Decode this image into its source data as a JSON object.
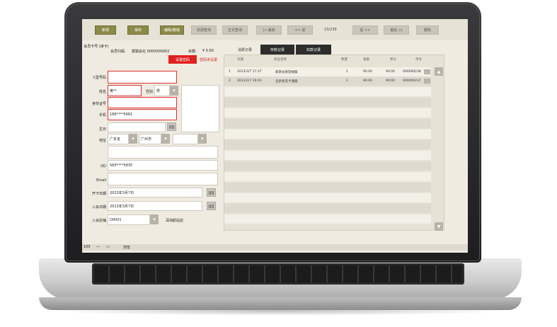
{
  "toolbar": {
    "buttons": [
      {
        "label": "新增",
        "style": "olive"
      },
      {
        "label": "保存",
        "style": "olive"
      },
      {
        "label": "编辑/撤销",
        "style": "olive"
      },
      {
        "label": "前调查询",
        "style": "gray"
      },
      {
        "label": "正式查询",
        "style": "gray"
      },
      {
        "label": "|< 最前",
        "style": "gray"
      },
      {
        "label": "<< 前",
        "style": "gray"
      },
      {
        "label": "后 >>",
        "style": "gray"
      },
      {
        "label": "最后 >|",
        "style": "gray"
      },
      {
        "label": "删除",
        "style": "gray"
      }
    ],
    "record_counter": "23/239"
  },
  "member": {
    "card_label": "会员卡号 (读卡)",
    "store_label": "会员归属:",
    "store_value": "猿猿会社 0000000002",
    "balance_label": "余额:",
    "balance_value": "¥ 0.00",
    "set_password_button": "设置密码",
    "reset_password_link": "密码未设置"
  },
  "form": {
    "fields": [
      {
        "label": "C型号码",
        "value": ""
      },
      {
        "label": "姓名",
        "value": "黄**"
      },
      {
        "label": "身份证号",
        "value": ""
      },
      {
        "label": "手机",
        "value": "186****5681"
      },
      {
        "label": "生日",
        "value": ""
      },
      {
        "label": "地址",
        "value": ""
      },
      {
        "label": "QQ",
        "value": "565****5835"
      },
      {
        "label": "Email",
        "value": ""
      },
      {
        "label": "开卡日期",
        "value": "2013年3月7日"
      },
      {
        "label": "入会日期",
        "value": "2013年3月7日"
      },
      {
        "label": "入会店铺",
        "value": "D0001"
      }
    ],
    "gender_label": "性别",
    "gender_value": "男",
    "province_value": "广东省",
    "city_value": "广州市",
    "store_name": "深圳航站店"
  },
  "tabs": [
    "消费记录",
    "存款记录",
    "扣款记录"
  ],
  "grid": {
    "headers": [
      "日期",
      "商品名称",
      "数量",
      "金额",
      "积分",
      "单号"
    ],
    "rows": [
      {
        "no": "1",
        "date": "2013/3/7 17:37",
        "product": "新款长款羽绒服",
        "qty": "1",
        "amount": "¥0.00",
        "points": "¥0.00",
        "order": "000000238"
      },
      {
        "no": "2",
        "date": "2013/3/7 16:03",
        "product": "全新冬装卡通服",
        "qty": "1",
        "amount": "¥0.00",
        "points": "¥0.00",
        "order": "000000237"
      }
    ]
  },
  "status": {
    "zoom": "100",
    "mode": "浏览"
  }
}
